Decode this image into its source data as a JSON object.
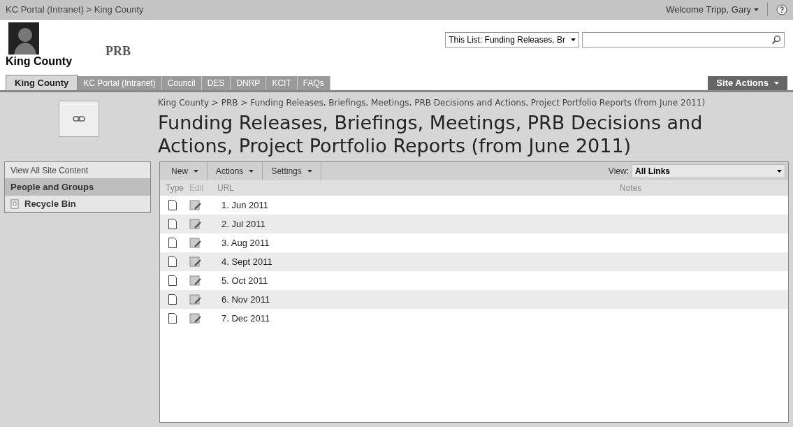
{
  "top_bar": {
    "breadcrumb": "KC Portal (Intranet) > King County",
    "welcome": "Welcome Tripp, Gary"
  },
  "header": {
    "logo_caption": "King County",
    "site_title": "PRB",
    "search_scope": "This List: Funding Releases, Br"
  },
  "tabs": [
    {
      "label": "King County",
      "selected": true
    },
    {
      "label": "KC Portal (Intranet)",
      "selected": false
    },
    {
      "label": "Council",
      "selected": false
    },
    {
      "label": "DES",
      "selected": false
    },
    {
      "label": "DNRP",
      "selected": false
    },
    {
      "label": "KCIT",
      "selected": false
    },
    {
      "label": "FAQs",
      "selected": false
    }
  ],
  "site_actions": "Site Actions",
  "breadcrumb": "King County > PRB > Funding Releases, Briefings, Meetings, PRB Decisions and Actions, Project Portfolio Reports (from June 2011)",
  "page_title": "Funding Releases, Briefings, Meetings, PRB Decisions and Actions, Project Portfolio Reports (from June 2011)",
  "sidebar": {
    "items": [
      {
        "label": "View All Site Content",
        "selected": false,
        "kind": "link"
      },
      {
        "label": "People and Groups",
        "selected": true,
        "kind": "heading"
      },
      {
        "label": "Recycle Bin",
        "selected": false,
        "kind": "recycle"
      }
    ]
  },
  "toolbar": {
    "menus": [
      "New",
      "Actions",
      "Settings"
    ],
    "view_label": "View:",
    "view_value": "All Links"
  },
  "table": {
    "columns": [
      "Type",
      "Edit",
      "URL",
      "Notes"
    ],
    "rows": [
      {
        "url": "1. Jun 2011"
      },
      {
        "url": "2. Jul 2011"
      },
      {
        "url": "3. Aug 2011"
      },
      {
        "url": "4. Sept 2011"
      },
      {
        "url": "5. Oct 2011"
      },
      {
        "url": "6. Nov 2011"
      },
      {
        "url": "7. Dec 2011"
      }
    ]
  }
}
